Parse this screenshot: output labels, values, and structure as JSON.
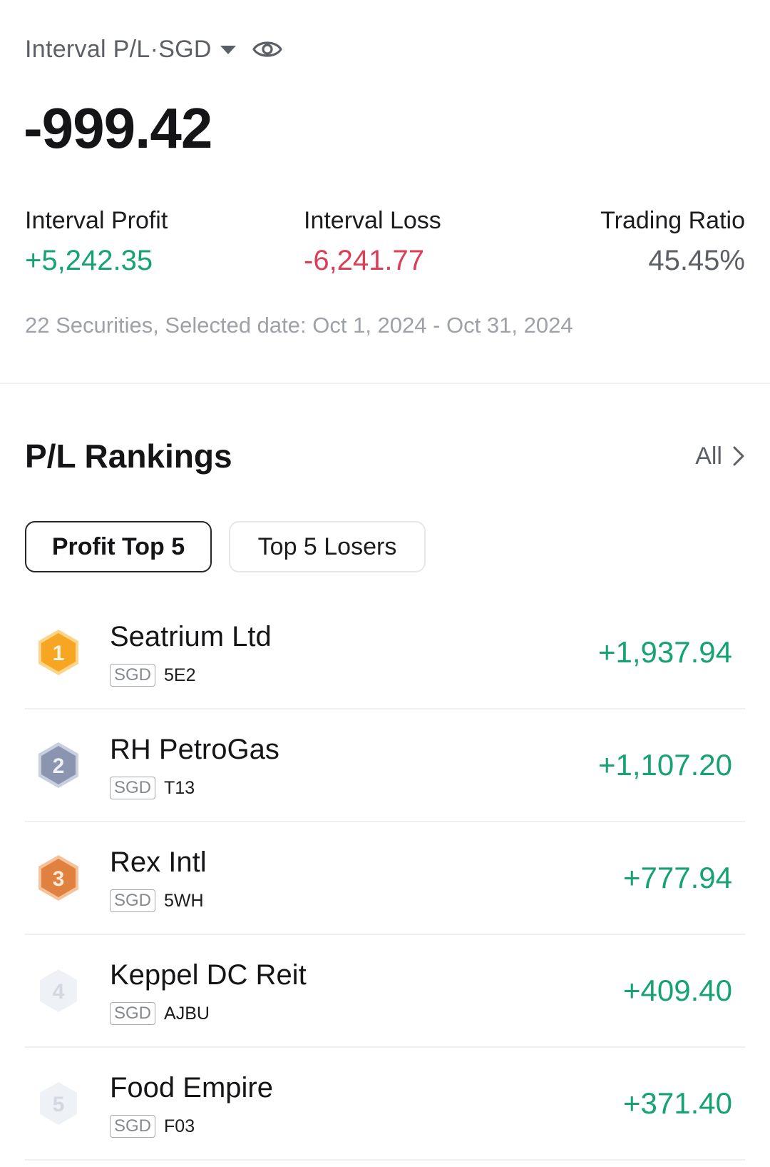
{
  "summary": {
    "title": "Interval P/L·SGD",
    "value": "-999.42",
    "profit_label": "Interval Profit",
    "profit_value": "+5,242.35",
    "loss_label": "Interval Loss",
    "loss_value": "-6,241.77",
    "ratio_label": "Trading Ratio",
    "ratio_value": "45.45%",
    "footnote": "22 Securities, Selected date: Oct 1, 2024 - Oct 31, 2024"
  },
  "rankings": {
    "title": "P/L Rankings",
    "all_label": "All",
    "tabs": [
      {
        "label": "Profit Top 5",
        "active": true
      },
      {
        "label": "Top 5 Losers",
        "active": false
      }
    ],
    "items": [
      {
        "rank": "1",
        "name": "Seatrium Ltd",
        "currency": "SGD",
        "code": "5E2",
        "amount": "+1,937.94"
      },
      {
        "rank": "2",
        "name": "RH PetroGas",
        "currency": "SGD",
        "code": "T13",
        "amount": "+1,107.20"
      },
      {
        "rank": "3",
        "name": "Rex Intl",
        "currency": "SGD",
        "code": "5WH",
        "amount": "+777.94"
      },
      {
        "rank": "4",
        "name": "Keppel DC Reit",
        "currency": "SGD",
        "code": "AJBU",
        "amount": "+409.40"
      },
      {
        "rank": "5",
        "name": "Food Empire",
        "currency": "SGD",
        "code": "F03",
        "amount": "+371.40"
      }
    ]
  },
  "colors": {
    "positive": "#17a271",
    "negative": "#dd3e57",
    "badge_gold": "#f6a623",
    "badge_silver": "#8c95b0",
    "badge_bronze": "#e0813f",
    "badge_plain": "#eef1f5"
  },
  "icons": {
    "visibility": "eye-icon",
    "dropdown": "caret-down-icon",
    "all_arrow": "chevron-right-icon",
    "rank_badge": "hexagon-rank-badge-icon"
  }
}
